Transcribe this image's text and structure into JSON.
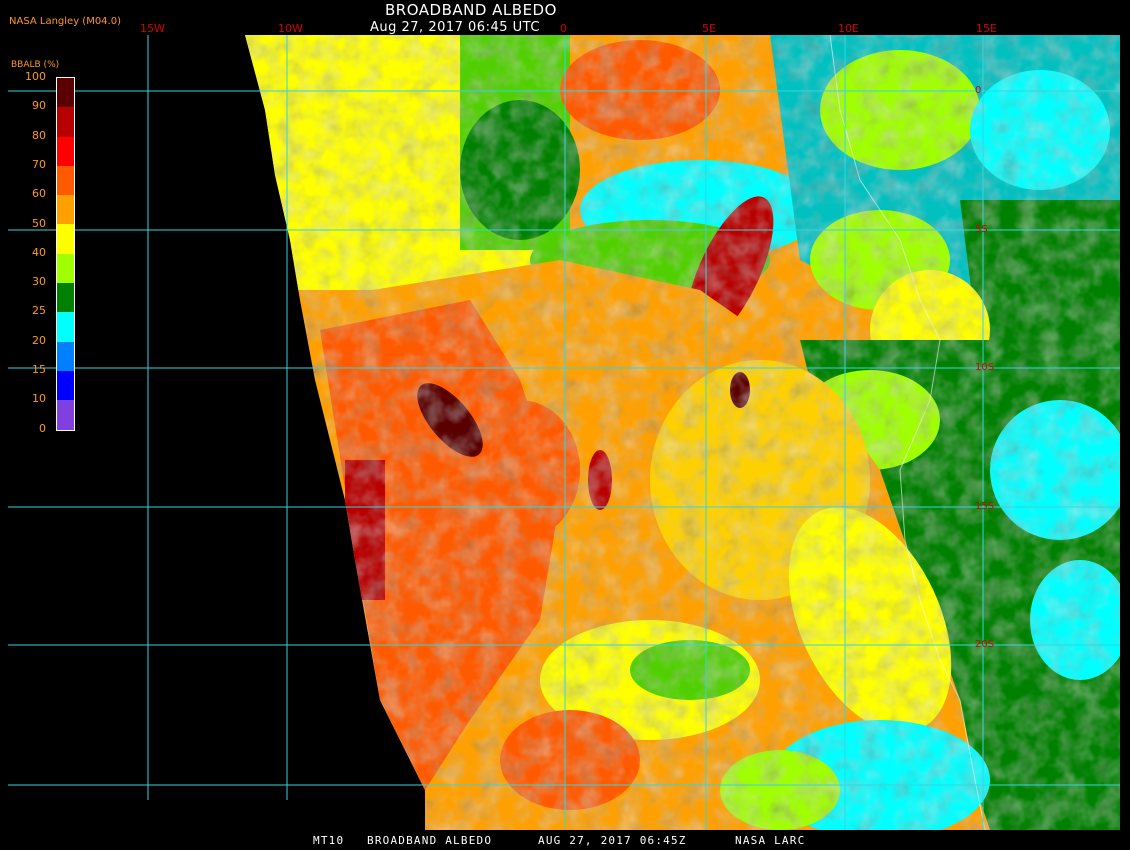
{
  "title": "BROADBAND ALBEDO",
  "timestamp": "Aug 27, 2017 06:45 UTC",
  "brand": "NASA Langley (M04.0)",
  "footer": {
    "product": "MT10",
    "name": "BROADBAND ALBEDO",
    "datetime": "AUG 27, 2017 06:45Z",
    "org": "NASA LARC"
  },
  "longitude_labels": [
    "15W",
    "10W",
    "0",
    "5E",
    "10E",
    "15E"
  ],
  "latitude_labels": [
    "0",
    "5S",
    "10S",
    "15S",
    "20S"
  ],
  "legend": {
    "title": "BBALB (%)",
    "ticks": [
      "100",
      "90",
      "80",
      "70",
      "60",
      "50",
      "40",
      "30",
      "25",
      "20",
      "15",
      "10",
      "0"
    ],
    "colors": [
      "#5a0000",
      "#b80000",
      "#ff0000",
      "#ff5a00",
      "#ffa000",
      "#ffff00",
      "#a0ff00",
      "#008000",
      "#00ffff",
      "#0080ff",
      "#0000ff",
      "#8040e0"
    ]
  },
  "grid_color": "#33d6e0"
}
